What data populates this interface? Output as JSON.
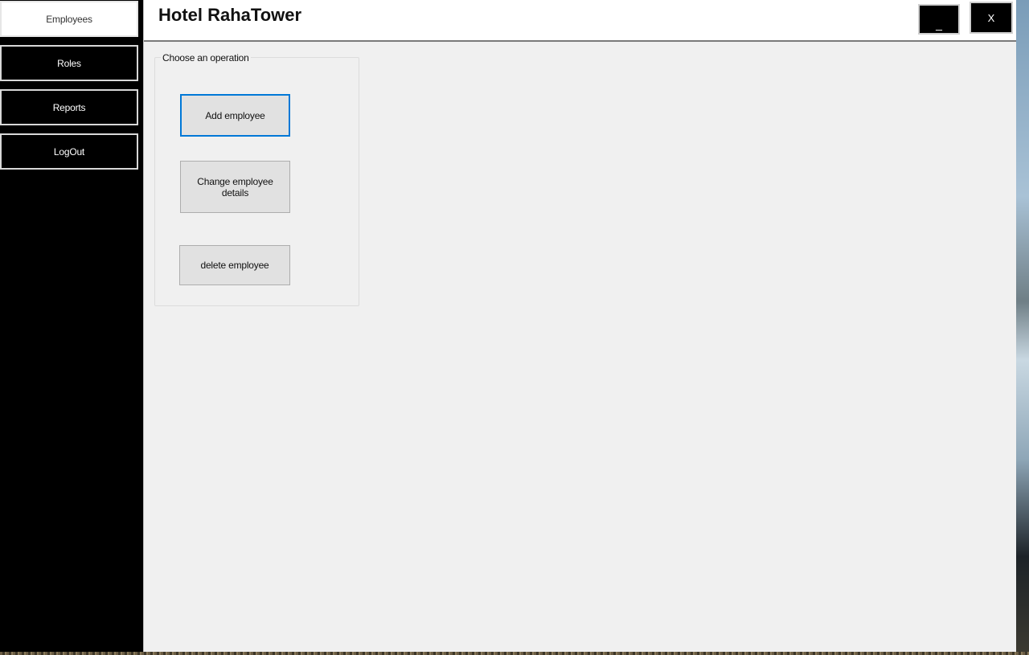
{
  "window": {
    "title": "Hotel RahaTower",
    "minimize_label": "_",
    "close_label": "X"
  },
  "sidebar": {
    "items": [
      {
        "label": "Employees",
        "active": true
      },
      {
        "label": "Roles",
        "active": false
      },
      {
        "label": "Reports",
        "active": false
      },
      {
        "label": "LogOut",
        "active": false
      }
    ]
  },
  "main": {
    "group_title": "Choose an operation",
    "buttons": {
      "add": "Add employee",
      "change": "Change employee details",
      "delete": "delete employee"
    }
  },
  "colors": {
    "sidebar_bg": "#000000",
    "content_bg": "#f0f0f0",
    "focus_border": "#0078d7"
  }
}
